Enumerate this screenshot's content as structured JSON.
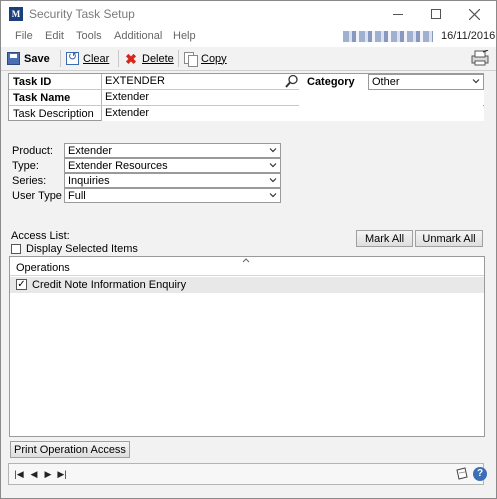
{
  "window": {
    "title": "Security Task Setup",
    "app_icon_label": "M"
  },
  "menu": {
    "items": [
      "File",
      "Edit",
      "Tools",
      "Additional",
      "Help"
    ],
    "date": "16/11/2016"
  },
  "toolbar": {
    "save_label": "Save",
    "clear_label": "Clear",
    "delete_label": "Delete",
    "copy_label": "Copy"
  },
  "header": {
    "task_id_label": "Task ID",
    "task_id_value": "EXTENDER",
    "task_name_label": "Task Name",
    "task_name_value": "Extender",
    "task_desc_label": "Task Description",
    "task_desc_value": "Extender",
    "category_label": "Category",
    "category_value": "Other"
  },
  "product_panel": {
    "product_label": "Product:",
    "product_value": "Extender",
    "type_label": "Type:",
    "type_value": "Extender Resources",
    "series_label": "Series:",
    "series_value": "Inquiries",
    "user_type_label": "User Type",
    "user_type_value": "Full"
  },
  "access": {
    "list_label": "Access List:",
    "display_selected_label": "Display Selected Items",
    "display_selected_checked": false,
    "mark_all_label": "Mark All",
    "unmark_all_label": "Unmark All",
    "operations_header": "Operations",
    "operations": [
      {
        "label": "Credit Note Information Enquiry",
        "checked": true
      }
    ],
    "print_button_label": "Print Operation Access"
  },
  "colors": {
    "accent": "#3a6fb8",
    "delete_red": "#d9261c",
    "row_highlight": "#e8e8e8"
  }
}
